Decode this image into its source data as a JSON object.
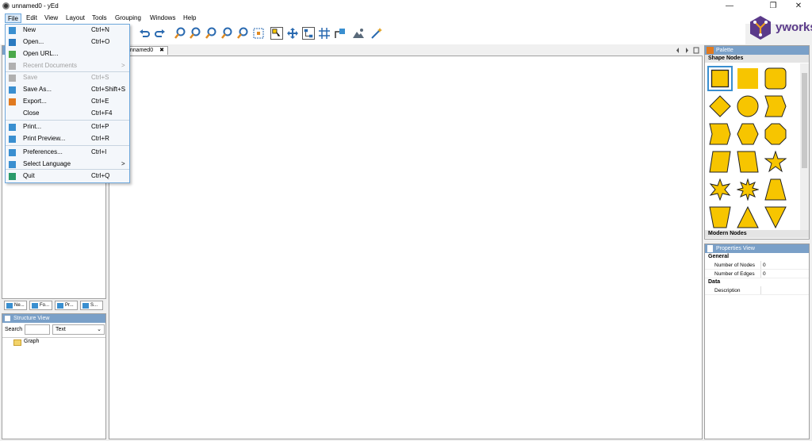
{
  "window": {
    "title": "unnamed0 - yEd",
    "controls": [
      "—",
      "❐",
      "✕"
    ]
  },
  "menubar": [
    "File",
    "Edit",
    "View",
    "Layout",
    "Tools",
    "Grouping",
    "Windows",
    "Help"
  ],
  "file_menu": [
    {
      "label": "New",
      "shortcut": "Ctrl+N",
      "icon": "new-document-icon",
      "color": "#3a8fd0"
    },
    {
      "label": "Open...",
      "shortcut": "Ctrl+O",
      "icon": "open-folder-icon",
      "color": "#2a7ac0"
    },
    {
      "label": "Open URL...",
      "shortcut": "",
      "icon": "globe-icon",
      "color": "#4aa84a"
    },
    {
      "label": "Recent Documents",
      "shortcut": "",
      "icon": "recent-icon",
      "disabled": true,
      "submenu": true,
      "color": "#b0b0b0"
    },
    {
      "label": "Save",
      "shortcut": "Ctrl+S",
      "icon": "save-icon",
      "disabled": true,
      "color": "#b0b0b0"
    },
    {
      "label": "Save As...",
      "shortcut": "Ctrl+Shift+S",
      "icon": "save-as-icon",
      "color": "#3a8fd0"
    },
    {
      "label": "Export...",
      "shortcut": "Ctrl+E",
      "icon": "export-icon",
      "color": "#e07a20"
    },
    {
      "label": "Close",
      "shortcut": "Ctrl+F4",
      "icon": "",
      "color": ""
    },
    {
      "label": "Print...",
      "shortcut": "Ctrl+P",
      "icon": "print-icon",
      "color": "#3a8fd0"
    },
    {
      "label": "Print Preview...",
      "shortcut": "Ctrl+R",
      "icon": "print-preview-icon",
      "color": "#3a8fd0"
    },
    {
      "label": "Preferences...",
      "shortcut": "Ctrl+I",
      "icon": "preferences-icon",
      "color": "#3a8fd0"
    },
    {
      "label": "Select Language",
      "shortcut": "",
      "icon": "language-icon",
      "submenu": true,
      "color": "#3a8fd0"
    },
    {
      "label": "Quit",
      "shortcut": "Ctrl+Q",
      "icon": "quit-icon",
      "color": "#2a9a6a"
    }
  ],
  "submenu_arrow": ">",
  "doc_tab": {
    "label": "unnamed0",
    "close": "✖"
  },
  "palette": {
    "title": "Palette",
    "section1": "Shape Nodes",
    "section2": "Modern Nodes",
    "shape_color": "#f7c500"
  },
  "properties": {
    "title": "Properties View",
    "groups": [
      {
        "name": "General",
        "rows": [
          {
            "key": "Number of Nodes",
            "value": "0"
          },
          {
            "key": "Number of Edges",
            "value": "0"
          }
        ]
      },
      {
        "name": "Data",
        "rows": [
          {
            "key": "Description",
            "value": ""
          }
        ]
      }
    ]
  },
  "left_tabs": [
    "Ne...",
    "Fo...",
    "Pr...",
    "S..."
  ],
  "structure": {
    "title": "Structure View",
    "search_label": "Search",
    "search_value": "",
    "filter": "Text",
    "root": "Graph"
  },
  "logo": {
    "text": "yworks",
    "color": "#5b3a8a",
    "accent": "#f0a020"
  },
  "colors": {
    "accent": "#6fa8dc",
    "title_bar_blue": "#7aa0c8"
  }
}
